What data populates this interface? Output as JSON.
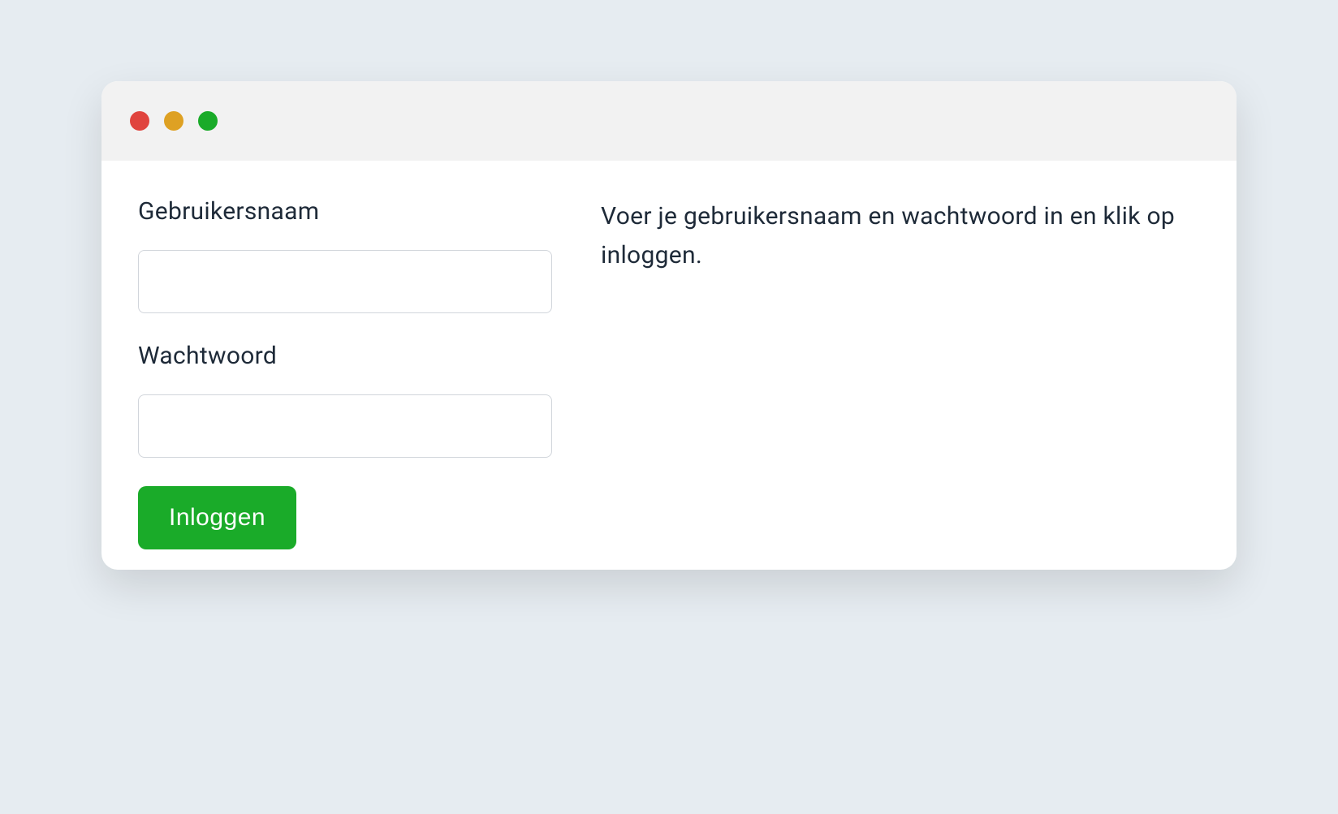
{
  "form": {
    "username_label": "Gebruikersnaam",
    "username_value": "",
    "password_label": "Wachtwoord",
    "password_value": "",
    "submit_label": "Inloggen"
  },
  "info": {
    "text": "Voer je gebruikersnaam en wachtwoord in en klik op inloggen."
  }
}
